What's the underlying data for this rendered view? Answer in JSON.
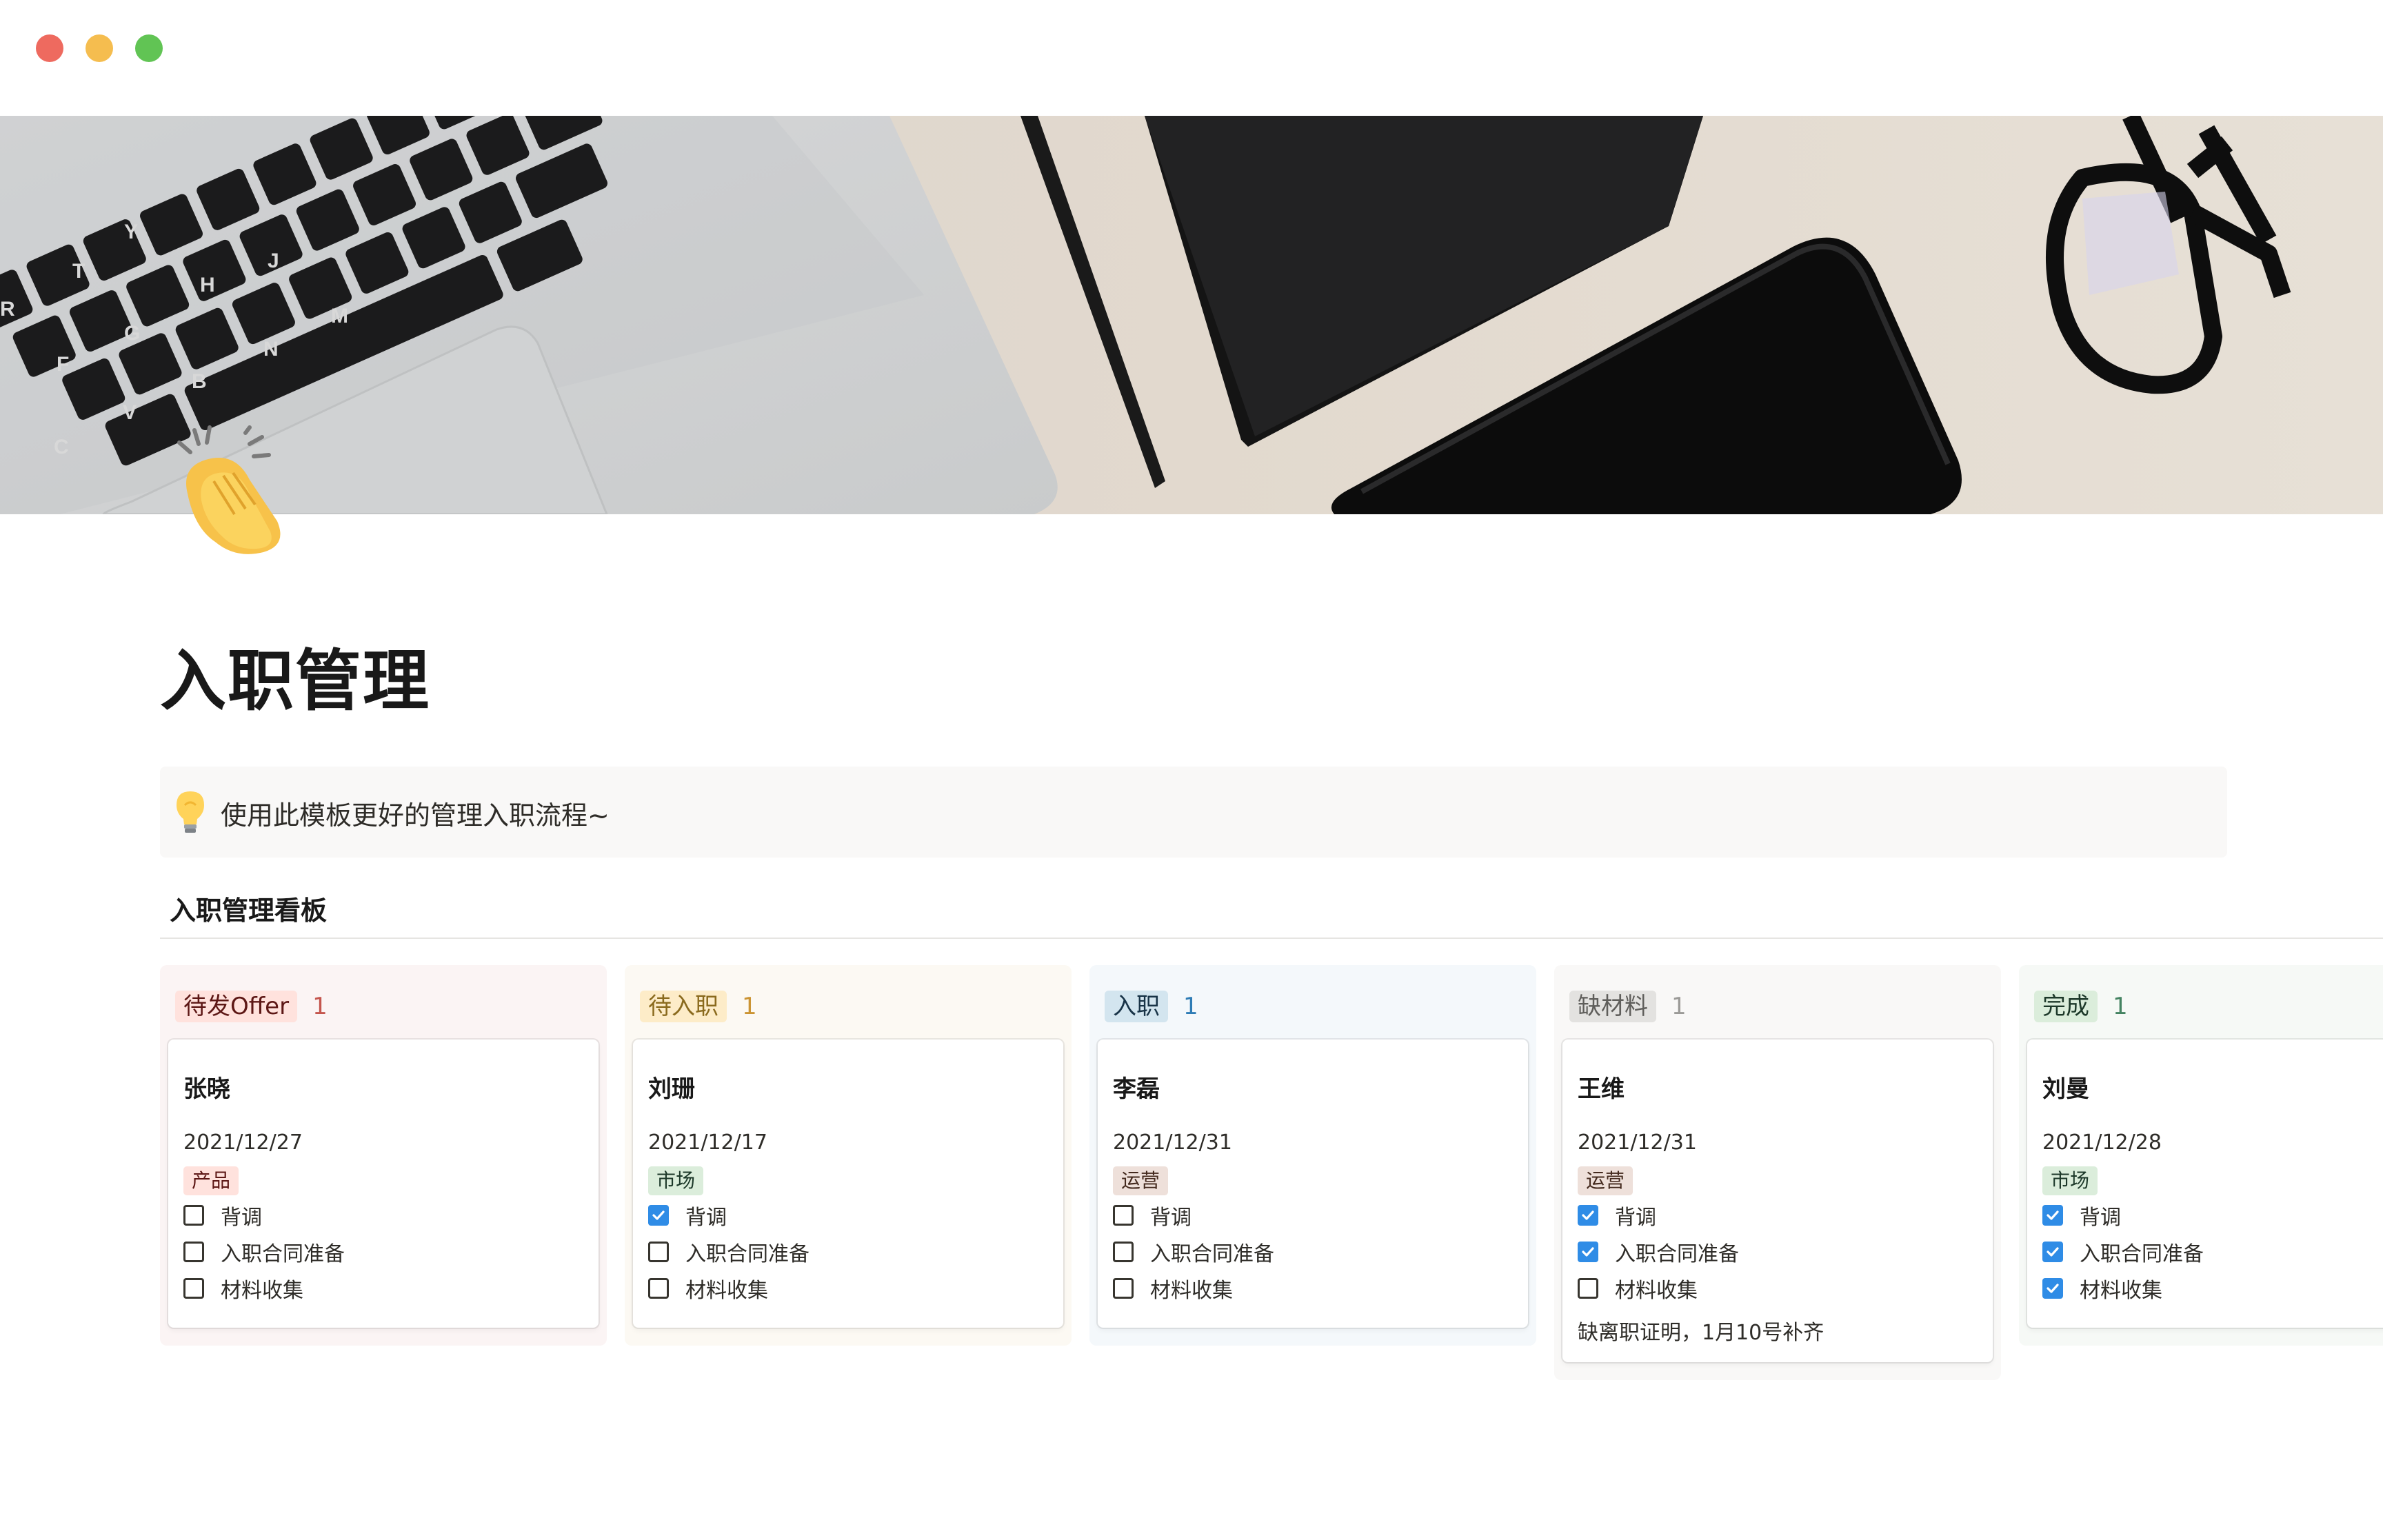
{
  "window": {
    "buttons": [
      "close",
      "minimize",
      "maximize"
    ]
  },
  "cover": {
    "description_icon": "laptop-desk-cover-image"
  },
  "page": {
    "icon": "clapping-hands-icon",
    "title": "入职管理",
    "callout": {
      "icon": "light-bulb-icon",
      "text": "使用此模板更好的管理入职流程~"
    }
  },
  "board": {
    "title": "入职管理看板",
    "columns": [
      {
        "status": "待发Offer",
        "count": "1",
        "colors": {
          "column_bg": "#fbf4f4",
          "tag_bg": "#ffe2dd",
          "tag_fg": "#5d1715",
          "count_fg": "#c4554d"
        },
        "card": {
          "name": "张晓",
          "date": "2021/12/27",
          "department": {
            "label": "产品",
            "bg": "#ffe2dd",
            "fg": "#5d1715"
          },
          "checklist": [
            {
              "label": "背调",
              "checked": false
            },
            {
              "label": "入职合同准备",
              "checked": false
            },
            {
              "label": "材料收集",
              "checked": false
            }
          ],
          "note": ""
        }
      },
      {
        "status": "待入职",
        "count": "1",
        "colors": {
          "column_bg": "#fcf9f3",
          "tag_bg": "#fdecc8",
          "tag_fg": "#8a6a1d",
          "count_fg": "#cb9433"
        },
        "card": {
          "name": "刘珊",
          "date": "2021/12/17",
          "department": {
            "label": "市场",
            "bg": "#dbeddb",
            "fg": "#1c3829"
          },
          "checklist": [
            {
              "label": "背调",
              "checked": true
            },
            {
              "label": "入职合同准备",
              "checked": false
            },
            {
              "label": "材料收集",
              "checked": false
            }
          ],
          "note": ""
        }
      },
      {
        "status": "入职",
        "count": "1",
        "colors": {
          "column_bg": "#f4f8fb",
          "tag_bg": "#d3e5ef",
          "tag_fg": "#183347",
          "count_fg": "#2e7cb5"
        },
        "card": {
          "name": "李磊",
          "date": "2021/12/31",
          "department": {
            "label": "运营",
            "bg": "#eee0da",
            "fg": "#442a1e"
          },
          "checklist": [
            {
              "label": "背调",
              "checked": false
            },
            {
              "label": "入职合同准备",
              "checked": false
            },
            {
              "label": "材料收集",
              "checked": false
            }
          ],
          "note": ""
        }
      },
      {
        "status": "缺材料",
        "count": "1",
        "colors": {
          "column_bg": "#f9f8f7",
          "tag_bg": "#e3e2e0",
          "tag_fg": "#5f5e5b",
          "count_fg": "#9b9a97"
        },
        "card": {
          "name": "王维",
          "date": "2021/12/31",
          "department": {
            "label": "运营",
            "bg": "#eee0da",
            "fg": "#442a1e"
          },
          "checklist": [
            {
              "label": "背调",
              "checked": true
            },
            {
              "label": "入职合同准备",
              "checked": true
            },
            {
              "label": "材料收集",
              "checked": false
            }
          ],
          "note": "缺离职证明，1月10号补齐"
        }
      },
      {
        "status": "完成",
        "count": "1",
        "colors": {
          "column_bg": "#f6f9f6",
          "tag_bg": "#dbeddb",
          "tag_fg": "#1c3829",
          "count_fg": "#448361"
        },
        "card": {
          "name": "刘曼",
          "date": "2021/12/28",
          "department": {
            "label": "市场",
            "bg": "#dbeddb",
            "fg": "#1c3829"
          },
          "checklist": [
            {
              "label": "背调",
              "checked": true
            },
            {
              "label": "入职合同准备",
              "checked": true
            },
            {
              "label": "材料收集",
              "checked": true
            }
          ],
          "note": ""
        }
      }
    ]
  }
}
